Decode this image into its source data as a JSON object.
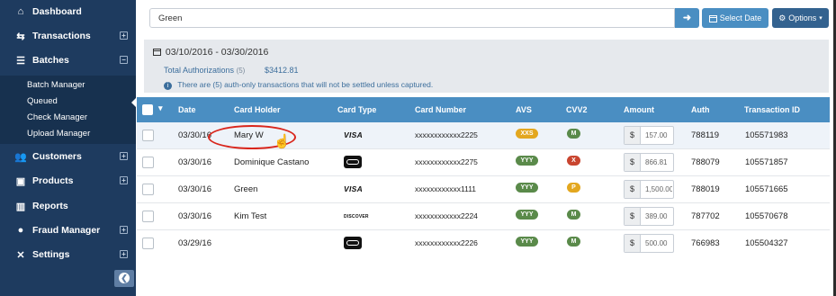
{
  "sidebar": {
    "items": [
      {
        "label": "Dashboard",
        "icon": "dashboard-icon",
        "glyph": "⌂",
        "expander": ""
      },
      {
        "label": "Transactions",
        "icon": "transactions-icon",
        "glyph": "⇆",
        "expander": "+"
      },
      {
        "label": "Batches",
        "icon": "batches-icon",
        "glyph": "☰",
        "expander": "−"
      },
      {
        "label": "Customers",
        "icon": "customers-icon",
        "glyph": "👥",
        "expander": "+"
      },
      {
        "label": "Products",
        "icon": "products-icon",
        "glyph": "▣",
        "expander": "+"
      },
      {
        "label": "Reports",
        "icon": "reports-icon",
        "glyph": "▥",
        "expander": ""
      },
      {
        "label": "Fraud Manager",
        "icon": "fraud-manager-icon",
        "glyph": "●",
        "expander": "+"
      },
      {
        "label": "Settings",
        "icon": "settings-icon",
        "glyph": "✕",
        "expander": "+"
      }
    ],
    "sub_items": [
      "Batch Manager",
      "Queued",
      "Check Manager",
      "Upload Manager"
    ],
    "collapse_glyph": "❮"
  },
  "search": {
    "value": "Green",
    "go_glyph": "➜",
    "date_label": "Select Date",
    "options_label": "Options"
  },
  "summary": {
    "date_range": "03/10/2016 - 03/30/2016",
    "total_label": "Total Authorizations",
    "total_count": "(5)",
    "total_amount": "$3412.81",
    "info_text": "There are (5) auth-only transactions that will not be settled unless captured."
  },
  "table": {
    "headers": [
      "Date",
      "Card Holder",
      "Card Type",
      "Card Number",
      "AVS",
      "CVV2",
      "Amount",
      "Auth",
      "Transaction ID"
    ],
    "currency_symbol": "$",
    "rows": [
      {
        "date": "03/30/16",
        "holder": "Mary W",
        "card_type": "VISA",
        "number": "xxxxxxxxxxxx2225",
        "avs": "XXS",
        "avs_color": "#e3a71f",
        "cvv": "M",
        "cvv_color": "#5a8a4a",
        "amount": "157.00",
        "auth": "788119",
        "txn": "105571983"
      },
      {
        "date": "03/30/16",
        "holder": "Dominique Castano",
        "card_type": "",
        "number": "xxxxxxxxxxxx2275",
        "avs": "YYY",
        "avs_color": "#5a8a4a",
        "cvv": "X",
        "cvv_color": "#c9452f",
        "amount": "866.81",
        "auth": "788079",
        "txn": "105571857"
      },
      {
        "date": "03/30/16",
        "holder": "Green",
        "card_type": "VISA",
        "number": "xxxxxxxxxxxx1111",
        "avs": "YYY",
        "avs_color": "#5a8a4a",
        "cvv": "P",
        "cvv_color": "#e3a71f",
        "amount": "1,500.00",
        "auth": "788019",
        "txn": "105571665"
      },
      {
        "date": "03/30/16",
        "holder": "Kim Test",
        "card_type": "DISCOVER",
        "number": "xxxxxxxxxxxx2224",
        "avs": "YYY",
        "avs_color": "#5a8a4a",
        "cvv": "M",
        "cvv_color": "#5a8a4a",
        "amount": "389.00",
        "auth": "787702",
        "txn": "105570678"
      },
      {
        "date": "03/29/16",
        "holder": "",
        "card_type": "",
        "number": "xxxxxxxxxxxx2226",
        "avs": "YYY",
        "avs_color": "#5a8a4a",
        "cvv": "M",
        "cvv_color": "#5a8a4a",
        "amount": "500.00",
        "auth": "766983",
        "txn": "105504327"
      }
    ]
  },
  "colors": {
    "sidebar": "#1e3b5f",
    "accent": "#4a8ec2",
    "highlight_ring": "#d9261c"
  }
}
